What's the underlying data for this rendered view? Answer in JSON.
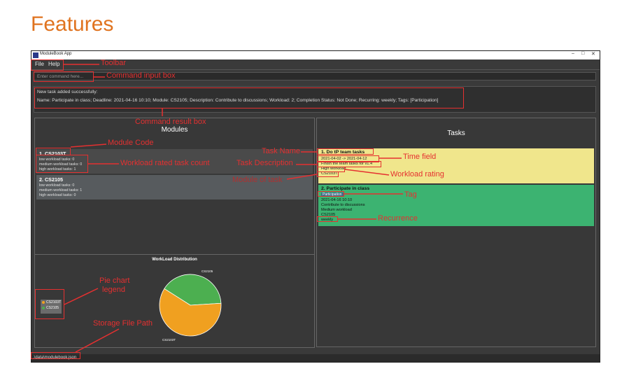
{
  "page": {
    "heading": "Features"
  },
  "window": {
    "title": "ModuleBook App",
    "controls": {
      "minimize": "–",
      "maximize": "□",
      "close": "✕"
    }
  },
  "menu": {
    "file": "File",
    "help": "Help"
  },
  "command": {
    "placeholder": "Enter command here..."
  },
  "result": {
    "line1": "New task added successfully:",
    "line2": "Name: Participate in class; Deadline: 2021-04-16 10:10; Module: CS2105; Description: Contribute to discussions; Workload: 2; Completion Status: Not Done; Recurring: weekly; Tags: [Participation]"
  },
  "modules": {
    "title": "Modules",
    "items": [
      {
        "name": "1.  CS2103T",
        "low": "low workload tasks: 0",
        "medium": "medium workload tasks: 0",
        "high": "high workload tasks: 1"
      },
      {
        "name": "2.  CS2105",
        "low": "low workload tasks: 0",
        "medium": "medium workload tasks: 1",
        "high": "high workload tasks: 0"
      }
    ]
  },
  "tasks": {
    "title": "Tasks",
    "items": [
      {
        "name": "1.  Do tP team tasks",
        "time": "2021-04-02 -> 2021-04-12",
        "description": "Finish the team tasks for v1.4",
        "workload": "High workload",
        "module": "CS2103T",
        "tag": "",
        "recurrence": "",
        "color": "#f0e68c"
      },
      {
        "name": "2.  Participate in class",
        "tag": "Participation",
        "time": "2021-04-16 10:10",
        "description": "Contribute to discussions",
        "workload": "Medium workload",
        "module": "CS2105",
        "recurrence": "weekly",
        "color": "#3cb371"
      }
    ]
  },
  "chart_data": {
    "type": "pie",
    "title": "WorkLoad Distribution",
    "categories": [
      "CS2103T",
      "CS2105"
    ],
    "values": [
      0.6,
      0.4
    ],
    "colors": [
      "#f0a020",
      "#4caf50"
    ],
    "legend": "left"
  },
  "status": {
    "path": ".\\data\\modulebook.json"
  },
  "annotations": {
    "toolbar": "Toolbar",
    "command_input": "Command input box",
    "command_result": "Command result box",
    "module_code": "Module Code",
    "workload_count": "Workload rated task count",
    "task_name": "Task Name",
    "task_description": "Task Description",
    "module_of_task": "Module of task",
    "time_field": "Time field",
    "workload_rating": "Workload rating",
    "tag": "Tag",
    "recurrence": "Recurrence",
    "pie_legend_1": "Pie chart",
    "pie_legend_2": "legend",
    "storage_path": "Storage File Path"
  },
  "colors": {
    "accent": "#e53030",
    "heading": "#e0731f"
  }
}
